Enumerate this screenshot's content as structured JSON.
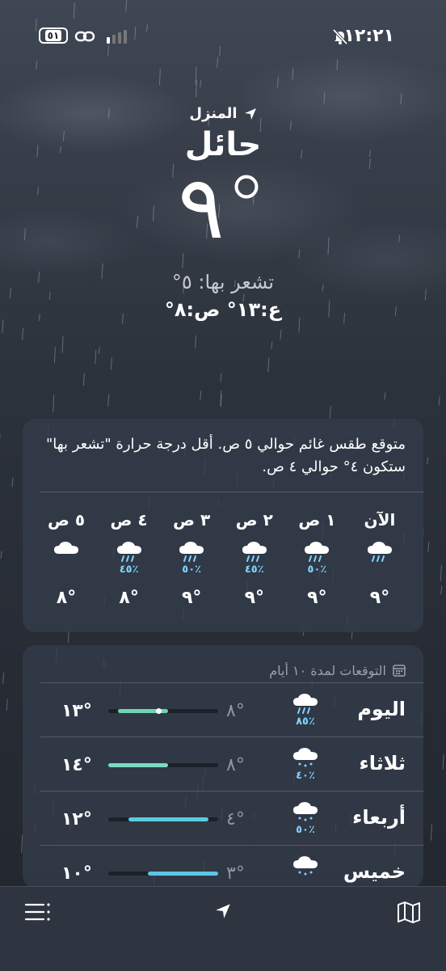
{
  "status_bar": {
    "time": "١٢:٢١",
    "battery": "٥١",
    "icons": [
      "bell-slash-icon",
      "link-icon",
      "signal-icon",
      "battery-icon"
    ]
  },
  "location": {
    "label": "المنزل",
    "city": "حائل",
    "temperature": "٩°",
    "feels_like": "تشعر بها: ٥°",
    "high_low": "ع:١٣° ص:٨°"
  },
  "hourly": {
    "summary": "متوقع طقس غائم حوالي ٥ ص. أقل درجة حرارة \"تشعر بها\" ستكون ٤° حوالي ٤ ص.",
    "hours": [
      {
        "label": "الآن",
        "icon": "cloud-rain-icon",
        "pct": "",
        "temp": "٩°"
      },
      {
        "label": "١ ص",
        "icon": "cloud-rain-icon",
        "pct": "٥٠٪",
        "temp": "٩°"
      },
      {
        "label": "٢ ص",
        "icon": "cloud-rain-icon",
        "pct": "٤٥٪",
        "temp": "٩°"
      },
      {
        "label": "٣ ص",
        "icon": "cloud-rain-icon",
        "pct": "٥٠٪",
        "temp": "٩°"
      },
      {
        "label": "٤ ص",
        "icon": "cloud-rain-icon",
        "pct": "٤٥٪",
        "temp": "٨°"
      },
      {
        "label": "٥ ص",
        "icon": "cloud-icon",
        "pct": "",
        "temp": "٨°"
      }
    ]
  },
  "daily": {
    "header": "التوقعات لمدة ١٠ أيام",
    "range_min": 3,
    "range_max": 14,
    "days": [
      {
        "name": "اليوم",
        "icon": "cloud-rain-icon",
        "pct": "٨٥٪",
        "low": "٨°",
        "high": "١٣°",
        "low_val": 8,
        "high_val": 13,
        "current_val": 9,
        "color": "#6fd3b0"
      },
      {
        "name": "ثلاثاء",
        "icon": "cloud-drizzle-icon",
        "pct": "٤٠٪",
        "low": "٨°",
        "high": "١٤°",
        "low_val": 8,
        "high_val": 14,
        "color": "#79dcc0"
      },
      {
        "name": "أربعاء",
        "icon": "cloud-drizzle-icon",
        "pct": "٥٠٪",
        "low": "٤°",
        "high": "١٢°",
        "low_val": 4,
        "high_val": 12,
        "color": "#5ccbe0"
      },
      {
        "name": "خميس",
        "icon": "cloud-drizzle-icon",
        "pct": "",
        "low": "٣°",
        "high": "١٠°",
        "low_val": 3,
        "high_val": 10,
        "color": "#5cc5e6"
      }
    ]
  },
  "toolbar": {
    "icons": [
      "list-icon",
      "location-arrow-icon",
      "map-icon"
    ]
  }
}
